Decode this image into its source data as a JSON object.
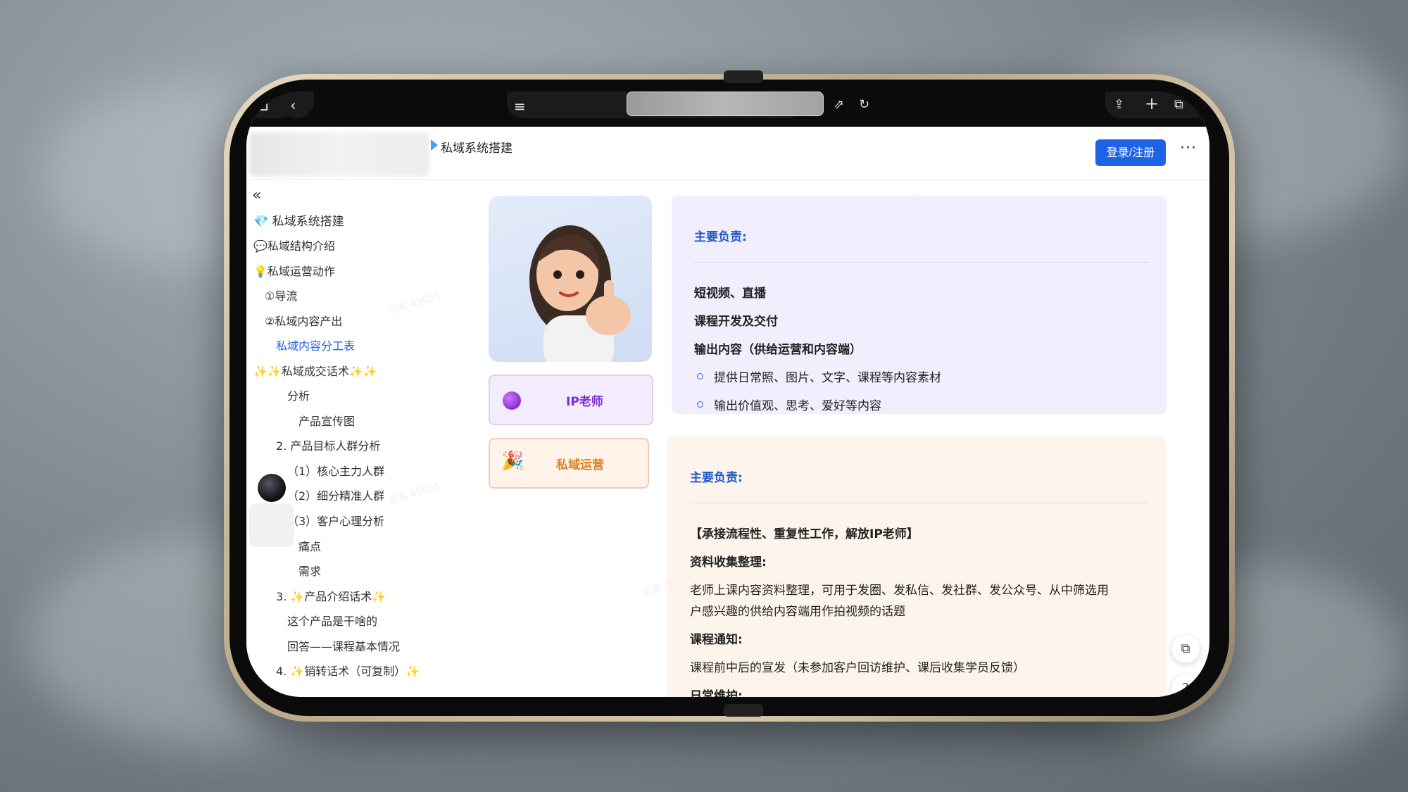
{
  "header": {
    "doc_title": "私域系统搭建",
    "login_label": "登录/注册",
    "more_label": "···"
  },
  "sidebar": {
    "collapse_icon": "«",
    "items": [
      {
        "label": "💎 私域系统搭建",
        "icon": "diamond-icon"
      },
      {
        "label": "💬私域结构介绍",
        "icon": "speech-bubble-icon"
      },
      {
        "label": "💡私域运营动作",
        "icon": "light-bulb-icon"
      },
      {
        "label": "①导流"
      },
      {
        "label": "②私域内容产出"
      },
      {
        "label": "私域内容分工表",
        "active": true
      },
      {
        "label": "✨✨私域成交话术✨✨"
      },
      {
        "label": "分析"
      },
      {
        "label": "产品宣传图"
      },
      {
        "label": "2. 产品目标人群分析"
      },
      {
        "label": "（1）核心主力人群"
      },
      {
        "label": "（2）细分精准人群"
      },
      {
        "label": "（3）客户心理分析"
      },
      {
        "label": "痛点"
      },
      {
        "label": "需求"
      },
      {
        "label": "3. ✨产品介绍话术✨"
      },
      {
        "label": "这个产品是干啥的"
      },
      {
        "label": "回答——课程基本情况"
      },
      {
        "label": "4. ✨销转话术（可复制）✨"
      }
    ]
  },
  "roles": [
    {
      "label": "IP老师",
      "color": "#7a2fd0",
      "icon": "purple-circle-icon"
    },
    {
      "label": "私域运营",
      "color": "#d9821f",
      "icon": "party-popper-icon"
    }
  ],
  "panel_ip": {
    "heading": "主要负责:",
    "lines": [
      "短视频、直播",
      "课程开发及交付",
      "输出内容（供给运营和内容端）"
    ],
    "bullets": [
      "提供日常照、图片、文字、课程等内容素材",
      "输出价值观、思考、爱好等内容"
    ]
  },
  "panel_ops": {
    "heading": "主要负责:",
    "line1": "【承接流程性、重复性工作，解放IP老师】",
    "sub1": "资料收集整理:",
    "text1a": "老师上课内容资料整理，可用于发圈、发私信、发社群、发公众号、从中筛选用",
    "text1b": "户感兴趣的供给内容端用作拍视频的话题",
    "sub2": "课程通知:",
    "text2": "课程前中后的宣发（未参加客户回访维护、课后收集学员反馈）",
    "sub3": "日常维护:"
  },
  "watermark": "访客 45051"
}
